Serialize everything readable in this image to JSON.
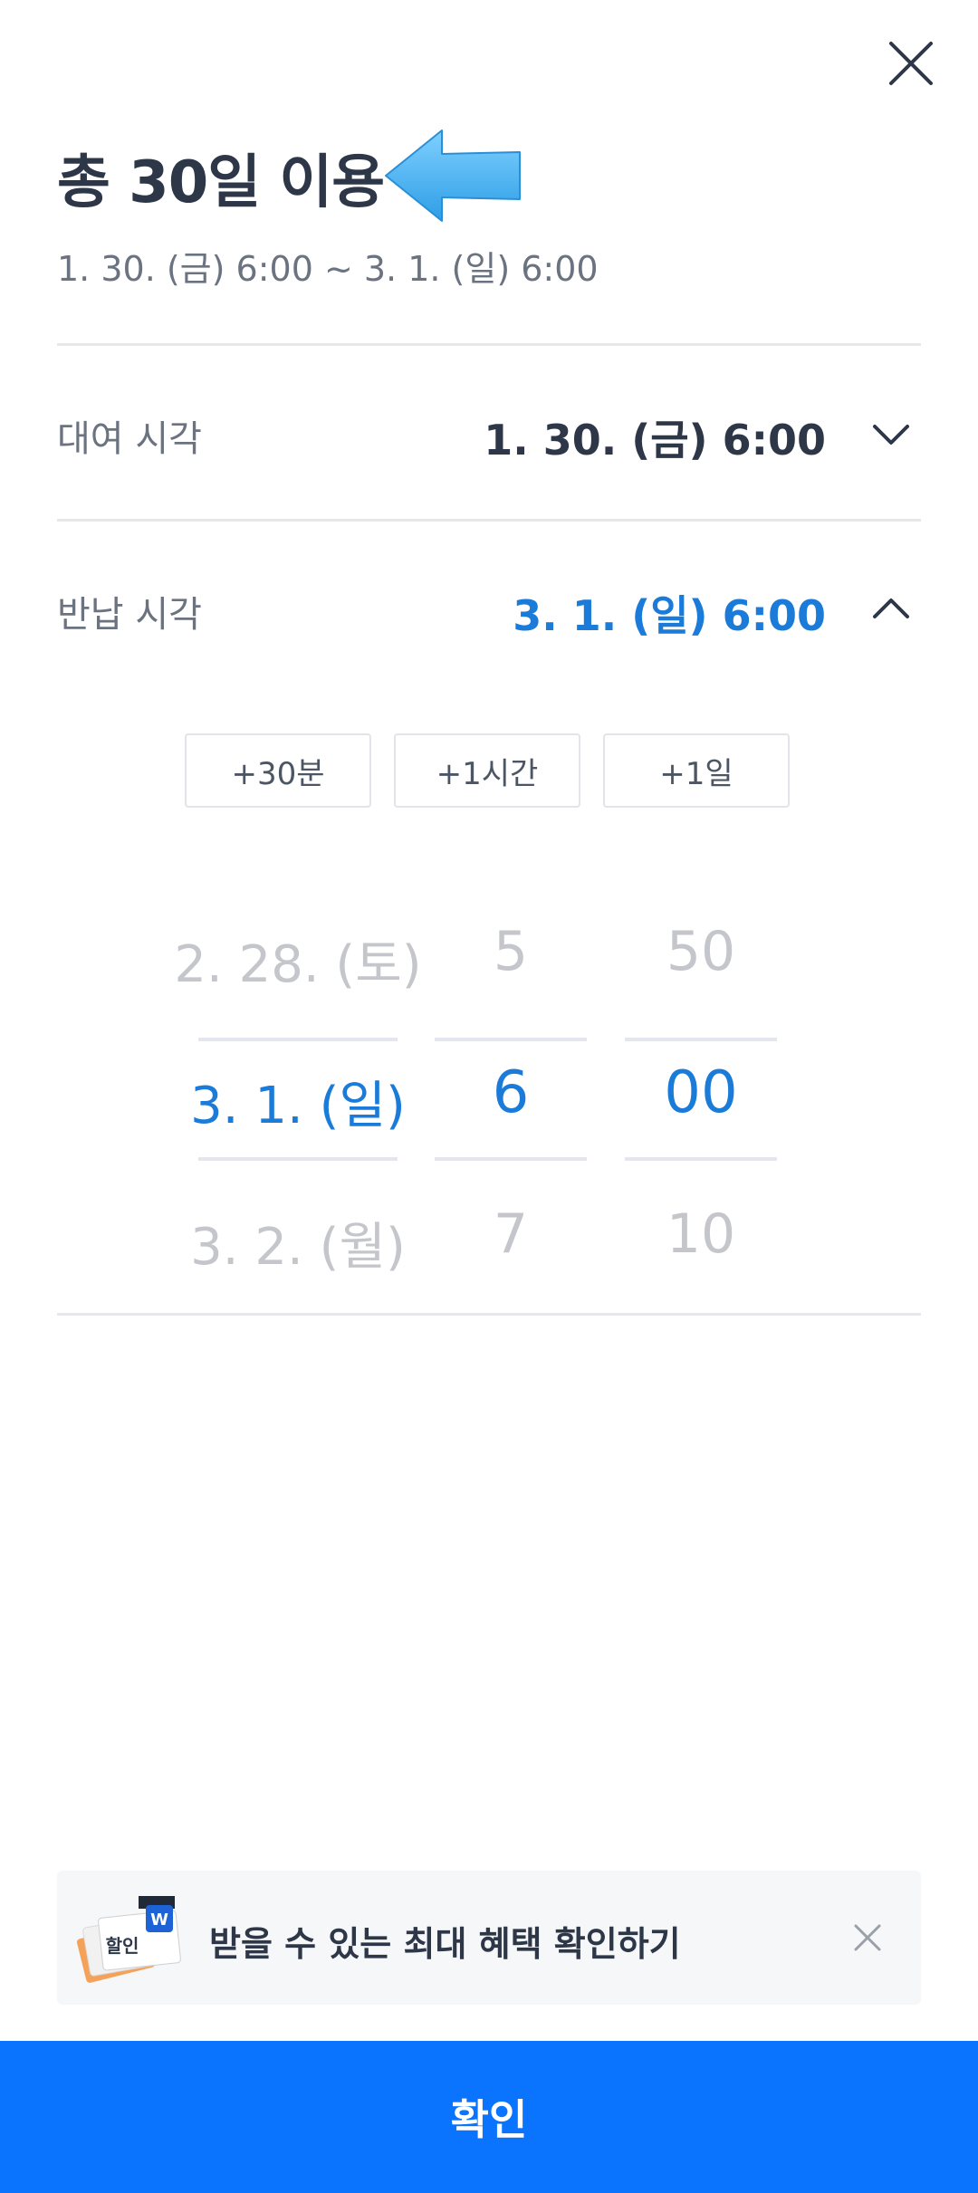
{
  "header": {
    "title": "총 30일 이용",
    "range": "1. 30. (금) 6:00 ~ 3. 1. (일) 6:00"
  },
  "rental": {
    "label": "대여 시각",
    "value": "1. 30. (금) 6:00"
  },
  "return_time": {
    "label": "반납 시각",
    "value": "3. 1. (일) 6:00"
  },
  "quick_buttons": [
    "+30분",
    "+1시간",
    "+1일"
  ],
  "picker": {
    "dates": [
      "2. 28. (토)",
      "3. 1. (일)",
      "3. 2. (월)"
    ],
    "hours": [
      "5",
      "6",
      "7"
    ],
    "minutes": [
      "50",
      "00",
      "10"
    ]
  },
  "banner": {
    "text": "받을 수 있는 최대 혜택 확인하기",
    "image_label": "할인"
  },
  "confirm_label": "확인",
  "colors": {
    "accent": "#0a74ff",
    "selected_text": "#1a7bd9",
    "annotation_arrow": "#4db5f5"
  }
}
